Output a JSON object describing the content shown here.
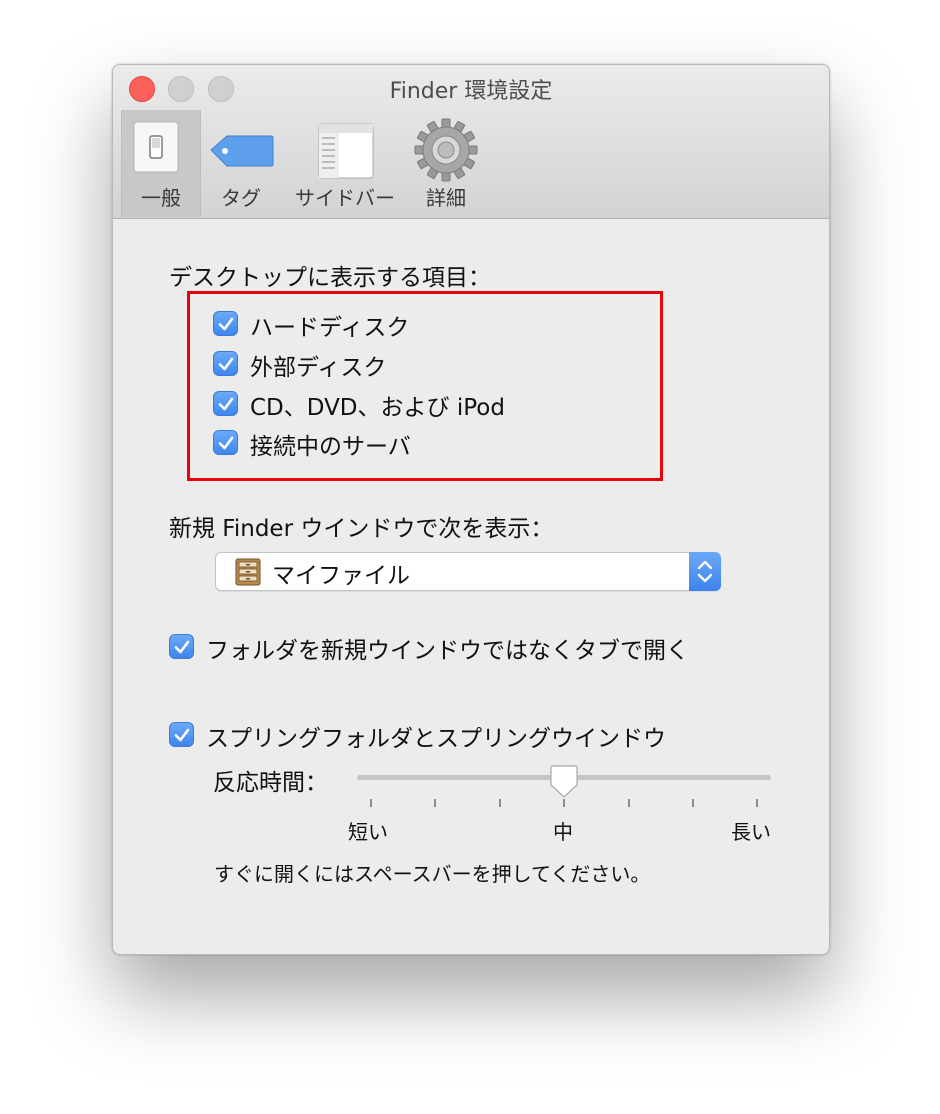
{
  "window": {
    "title": "Finder 環境設定"
  },
  "toolbar": {
    "items": [
      {
        "label": "一般",
        "icon": "switch-icon",
        "selected": true
      },
      {
        "label": "タグ",
        "icon": "tag-icon",
        "selected": false
      },
      {
        "label": "サイドバー",
        "icon": "sidebar-icon",
        "selected": false
      },
      {
        "label": "詳細",
        "icon": "gear-icon",
        "selected": false
      }
    ]
  },
  "desktop_section": {
    "label": "デスクトップに表示する項目：",
    "items": [
      {
        "label": "ハードディスク",
        "checked": true
      },
      {
        "label": "外部ディスク",
        "checked": true
      },
      {
        "label": "CD、DVD、および iPod",
        "checked": true
      },
      {
        "label": "接続中のサーバ",
        "checked": true
      }
    ]
  },
  "new_window": {
    "label": "新規 Finder ウインドウで次を表示：",
    "selected": "マイファイル",
    "icon": "file-cabinet-icon"
  },
  "options": {
    "open_in_tabs": {
      "label": "フォルダを新規ウインドウではなくタブで開く",
      "checked": true
    },
    "spring_loaded": {
      "label": "スプリングフォルダとスプリングウインドウ",
      "checked": true
    }
  },
  "delay": {
    "label": "反応時間：",
    "ticks": {
      "short": "短い",
      "medium": "中",
      "long": "長い"
    },
    "value_fraction": 0.5
  },
  "hint": "すぐに開くにはスペースバーを押してください。",
  "colors": {
    "accent": "#4a90f0",
    "close_button": "#fc605b",
    "highlight_box": "#e8000b"
  }
}
